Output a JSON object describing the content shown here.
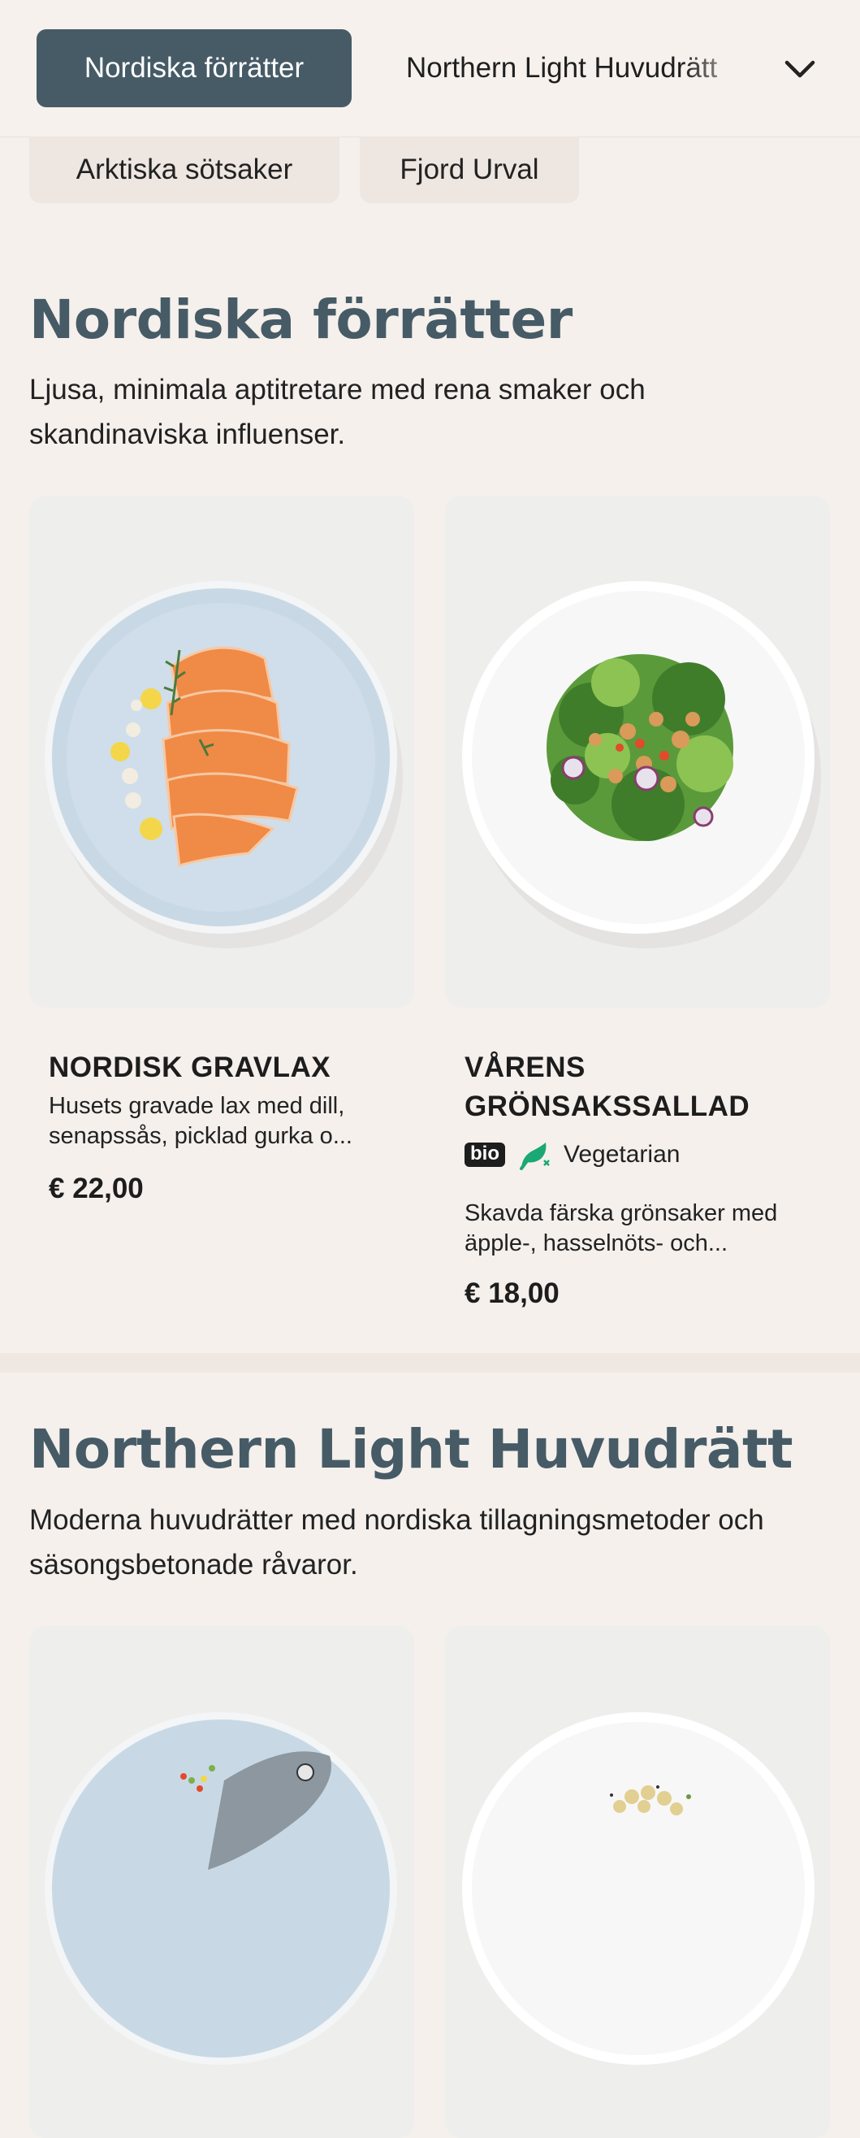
{
  "nav": {
    "active_tab": "Nordiska förrätter",
    "next_tab": "Northern Light Huvudrätt",
    "chips": [
      "Arktiska sötsaker",
      "Fjord Urval"
    ],
    "expand_icon": "chevron-down-icon"
  },
  "sections": [
    {
      "title": "Nordiska förrätter",
      "description": "Ljusa, minimala aptitretare med rena smaker och skandinaviska influenser.",
      "items": [
        {
          "name": "NORDISK GRAVLAX",
          "description": "Husets gravade lax med dill, senapssås, picklad gurka o...",
          "price": "€ 22,00",
          "image": "gravlax-plate"
        },
        {
          "name": "VÅRENS GRÖNSAKSSALLAD",
          "badge": "bio",
          "diet_label": "Vegetarian",
          "diet_icon": "vegetarian-icon",
          "description": "Skavda färska grönsaker med äpple-, hasselnöts- och...",
          "price": "€ 18,00",
          "image": "salad-plate"
        }
      ]
    },
    {
      "title": "Northern Light Huvudrätt",
      "description": "Moderna huvudrätter med nordiska tillagningsmetoder och säsongsbetonade råvaror.",
      "items": [
        {
          "image": "fish-plate"
        },
        {
          "image": "chickpea-plate"
        }
      ]
    }
  ],
  "colors": {
    "accent": "#465b66",
    "background": "#f5f0ec",
    "vegetarian": "#1aa874"
  }
}
